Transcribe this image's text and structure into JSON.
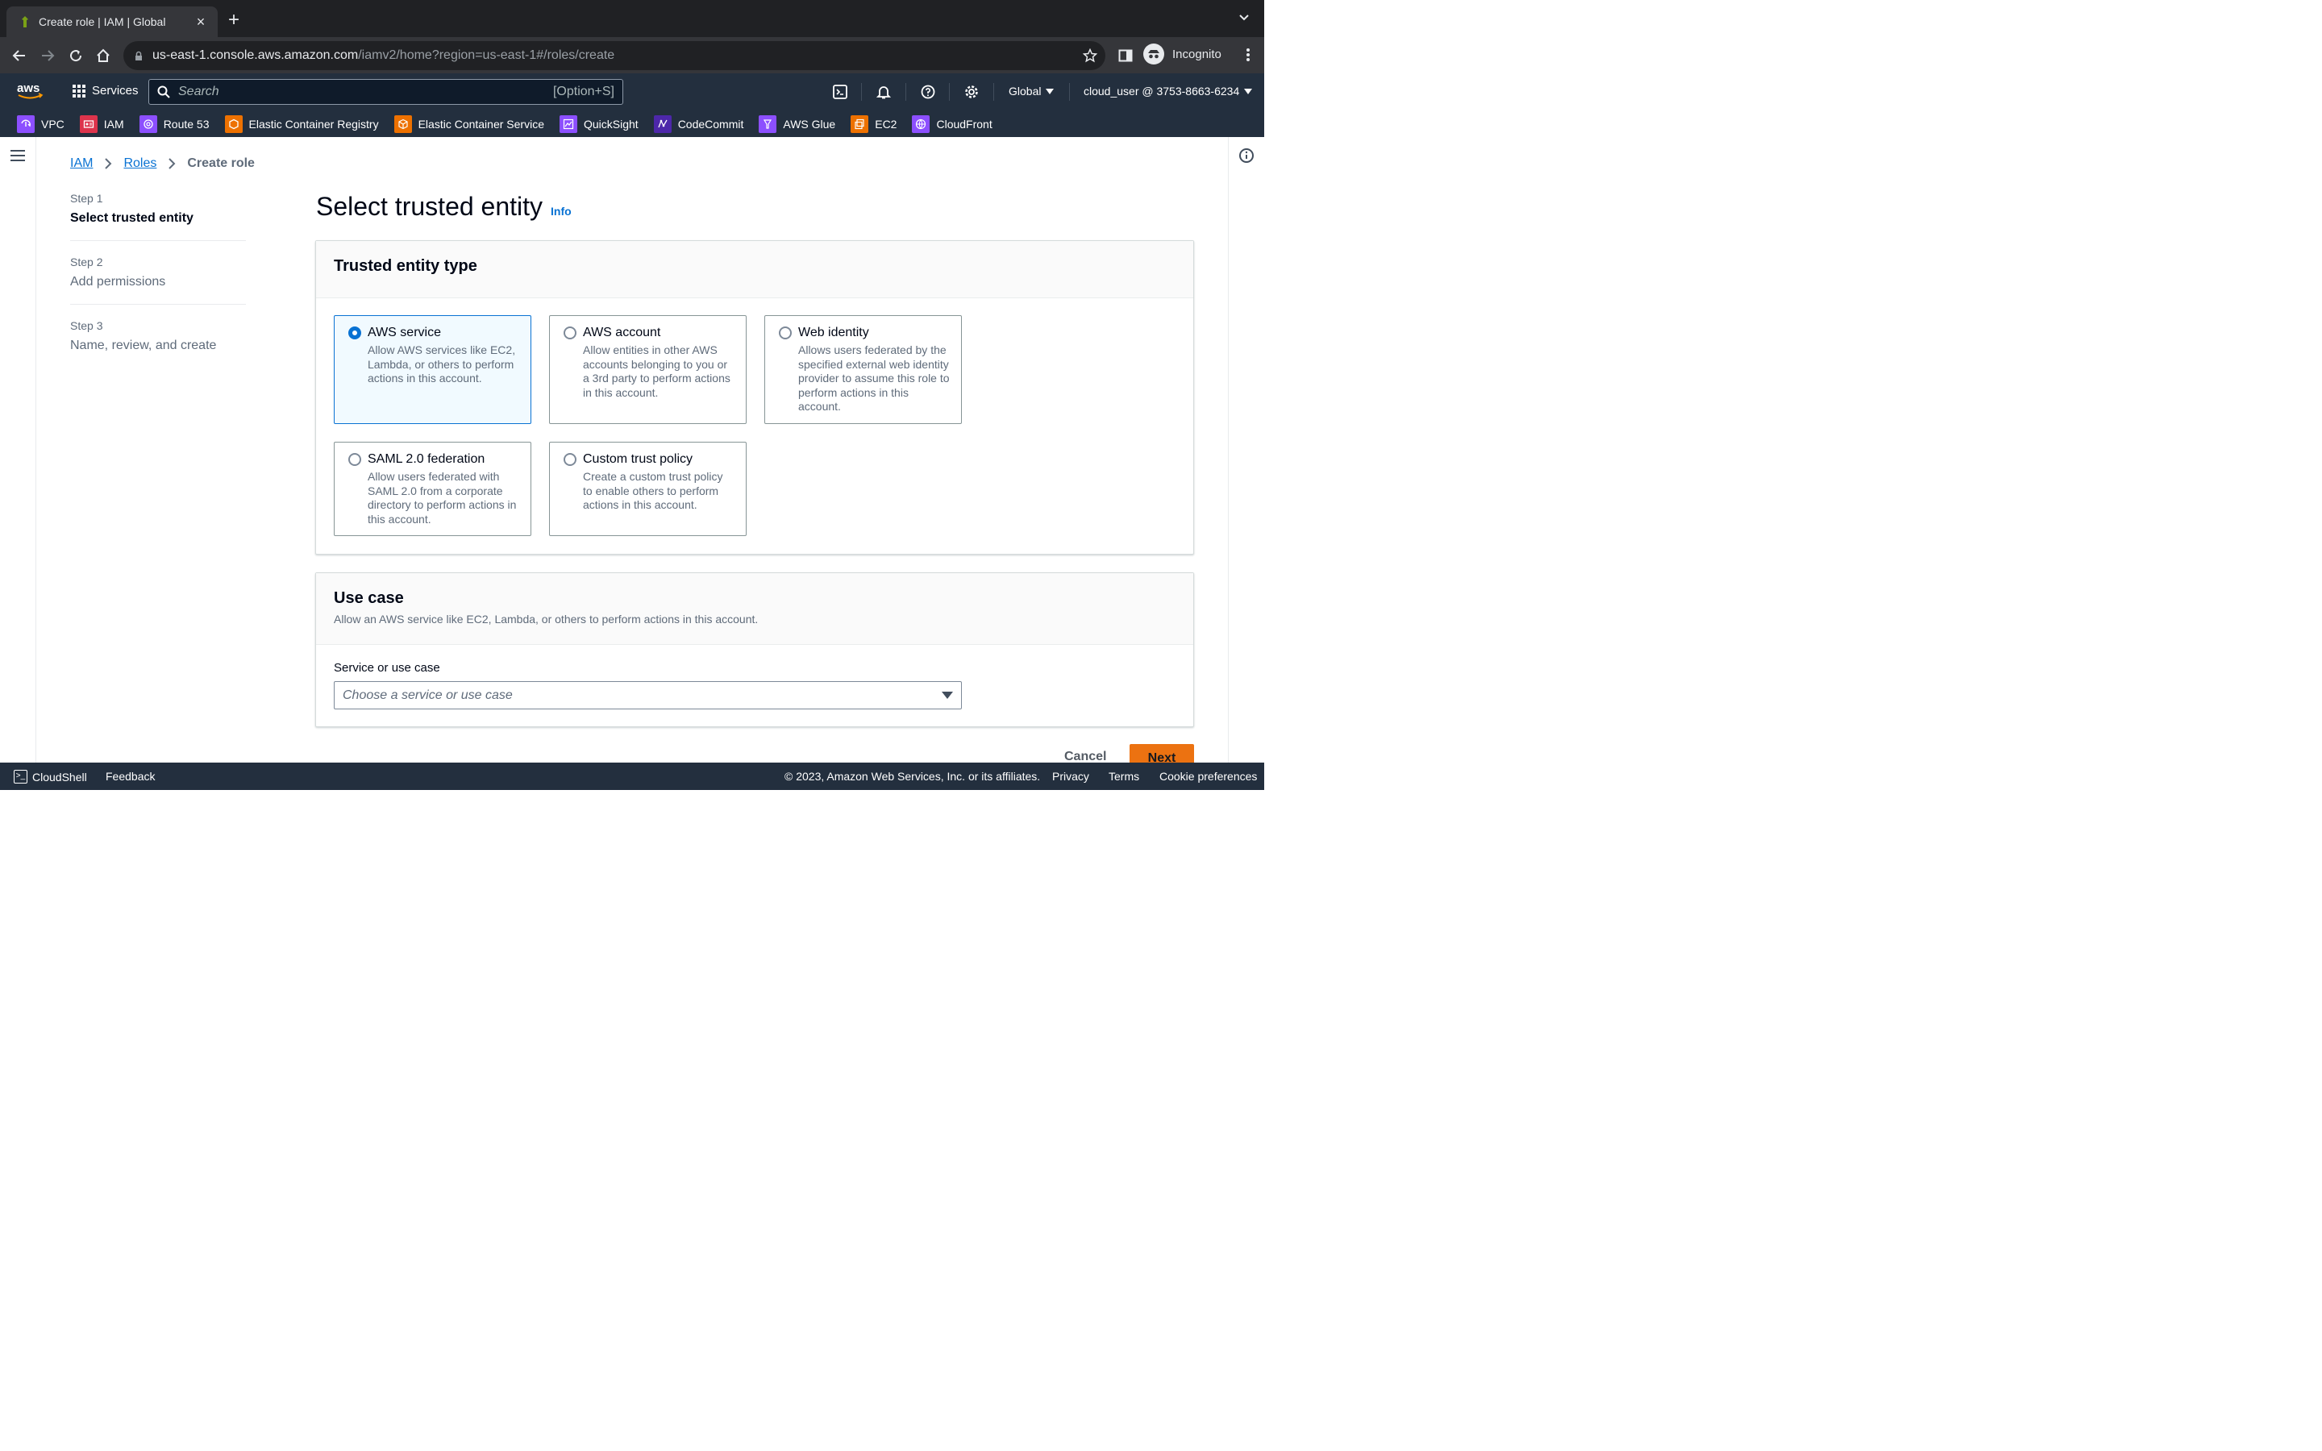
{
  "browser": {
    "tab_title": "Create role | IAM | Global",
    "url_host": "us-east-1.console.aws.amazon.com",
    "url_path": "/iamv2/home?region=us-east-1#/roles/create",
    "profile_label": "Incognito"
  },
  "aws_header": {
    "services_label": "Services",
    "search_placeholder": "Search",
    "search_shortcut": "[Option+S]",
    "region": "Global",
    "account": "cloud_user @ 3753-8663-6234"
  },
  "favorites": [
    {
      "label": "VPC",
      "color": "#8c4fff"
    },
    {
      "label": "IAM",
      "color": "#dd344c"
    },
    {
      "label": "Route 53",
      "color": "#8c4fff"
    },
    {
      "label": "Elastic Container Registry",
      "color": "#ed7100"
    },
    {
      "label": "Elastic Container Service",
      "color": "#ed7100"
    },
    {
      "label": "QuickSight",
      "color": "#8c4fff"
    },
    {
      "label": "CodeCommit",
      "color": "#4d27aa"
    },
    {
      "label": "AWS Glue",
      "color": "#8c4fff"
    },
    {
      "label": "EC2",
      "color": "#ed7100"
    },
    {
      "label": "CloudFront",
      "color": "#8c4fff"
    }
  ],
  "breadcrumb": {
    "iam": "IAM",
    "roles": "Roles",
    "current": "Create role"
  },
  "steps": [
    {
      "num": "Step 1",
      "name": "Select trusted entity"
    },
    {
      "num": "Step 2",
      "name": "Add permissions"
    },
    {
      "num": "Step 3",
      "name": "Name, review, and create"
    }
  ],
  "page": {
    "title": "Select trusted entity",
    "info": "Info"
  },
  "trusted_entity": {
    "heading": "Trusted entity type",
    "options": [
      {
        "title": "AWS service",
        "desc": "Allow AWS services like EC2, Lambda, or others to perform actions in this account."
      },
      {
        "title": "AWS account",
        "desc": "Allow entities in other AWS accounts belonging to you or a 3rd party to perform actions in this account."
      },
      {
        "title": "Web identity",
        "desc": "Allows users federated by the specified external web identity provider to assume this role to perform actions in this account."
      },
      {
        "title": "SAML 2.0 federation",
        "desc": "Allow users federated with SAML 2.0 from a corporate directory to perform actions in this account."
      },
      {
        "title": "Custom trust policy",
        "desc": "Create a custom trust policy to enable others to perform actions in this account."
      }
    ],
    "selected": "AWS service"
  },
  "use_case": {
    "heading": "Use case",
    "desc": "Allow an AWS service like EC2, Lambda, or others to perform actions in this account.",
    "field_label": "Service or use case",
    "placeholder": "Choose a service or use case"
  },
  "actions": {
    "cancel": "Cancel",
    "next": "Next"
  },
  "footer": {
    "cloudshell": "CloudShell",
    "feedback": "Feedback",
    "copyright": "© 2023, Amazon Web Services, Inc. or its affiliates.",
    "privacy": "Privacy",
    "terms": "Terms",
    "cookies": "Cookie preferences"
  },
  "colors": {
    "aws_nav": "#232f3e",
    "link": "#0972d3",
    "primary_button": "#ec7211"
  }
}
